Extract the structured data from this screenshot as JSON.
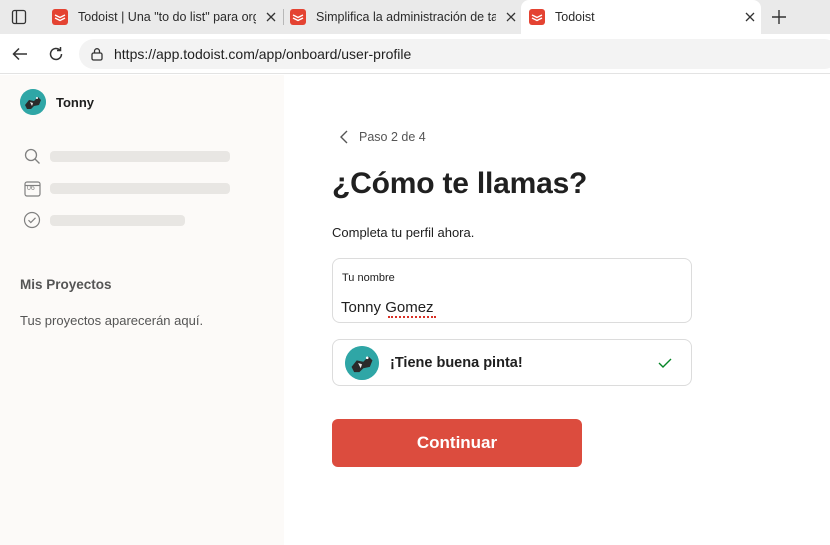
{
  "browser": {
    "tabs": [
      {
        "title": "Todoist | Una \"to do list\" para organizar",
        "active": false
      },
      {
        "title": "Simplifica la administración de tareas",
        "active": false
      },
      {
        "title": "Todoist",
        "active": true
      }
    ],
    "url": "https://app.todoist.com/app/onboard/user-profile"
  },
  "sidebar": {
    "user_name": "Tonny",
    "calendar_day": "06",
    "projects_title": "Mis Proyectos",
    "projects_empty": "Tus proyectos aparecerán aquí."
  },
  "onboarding": {
    "step": "Paso 2 de 4",
    "heading": "¿Cómo te llamas?",
    "subtitle": "Completa tu perfil ahora.",
    "name_label": "Tu nombre",
    "name_value": "Tonny Gomez",
    "preview_text": "¡Tiene buena pinta!",
    "continue_label": "Continuar"
  },
  "colors": {
    "brand": "#dc4c3e",
    "success": "#058527",
    "avatar_bg": "#2fa6a6"
  }
}
